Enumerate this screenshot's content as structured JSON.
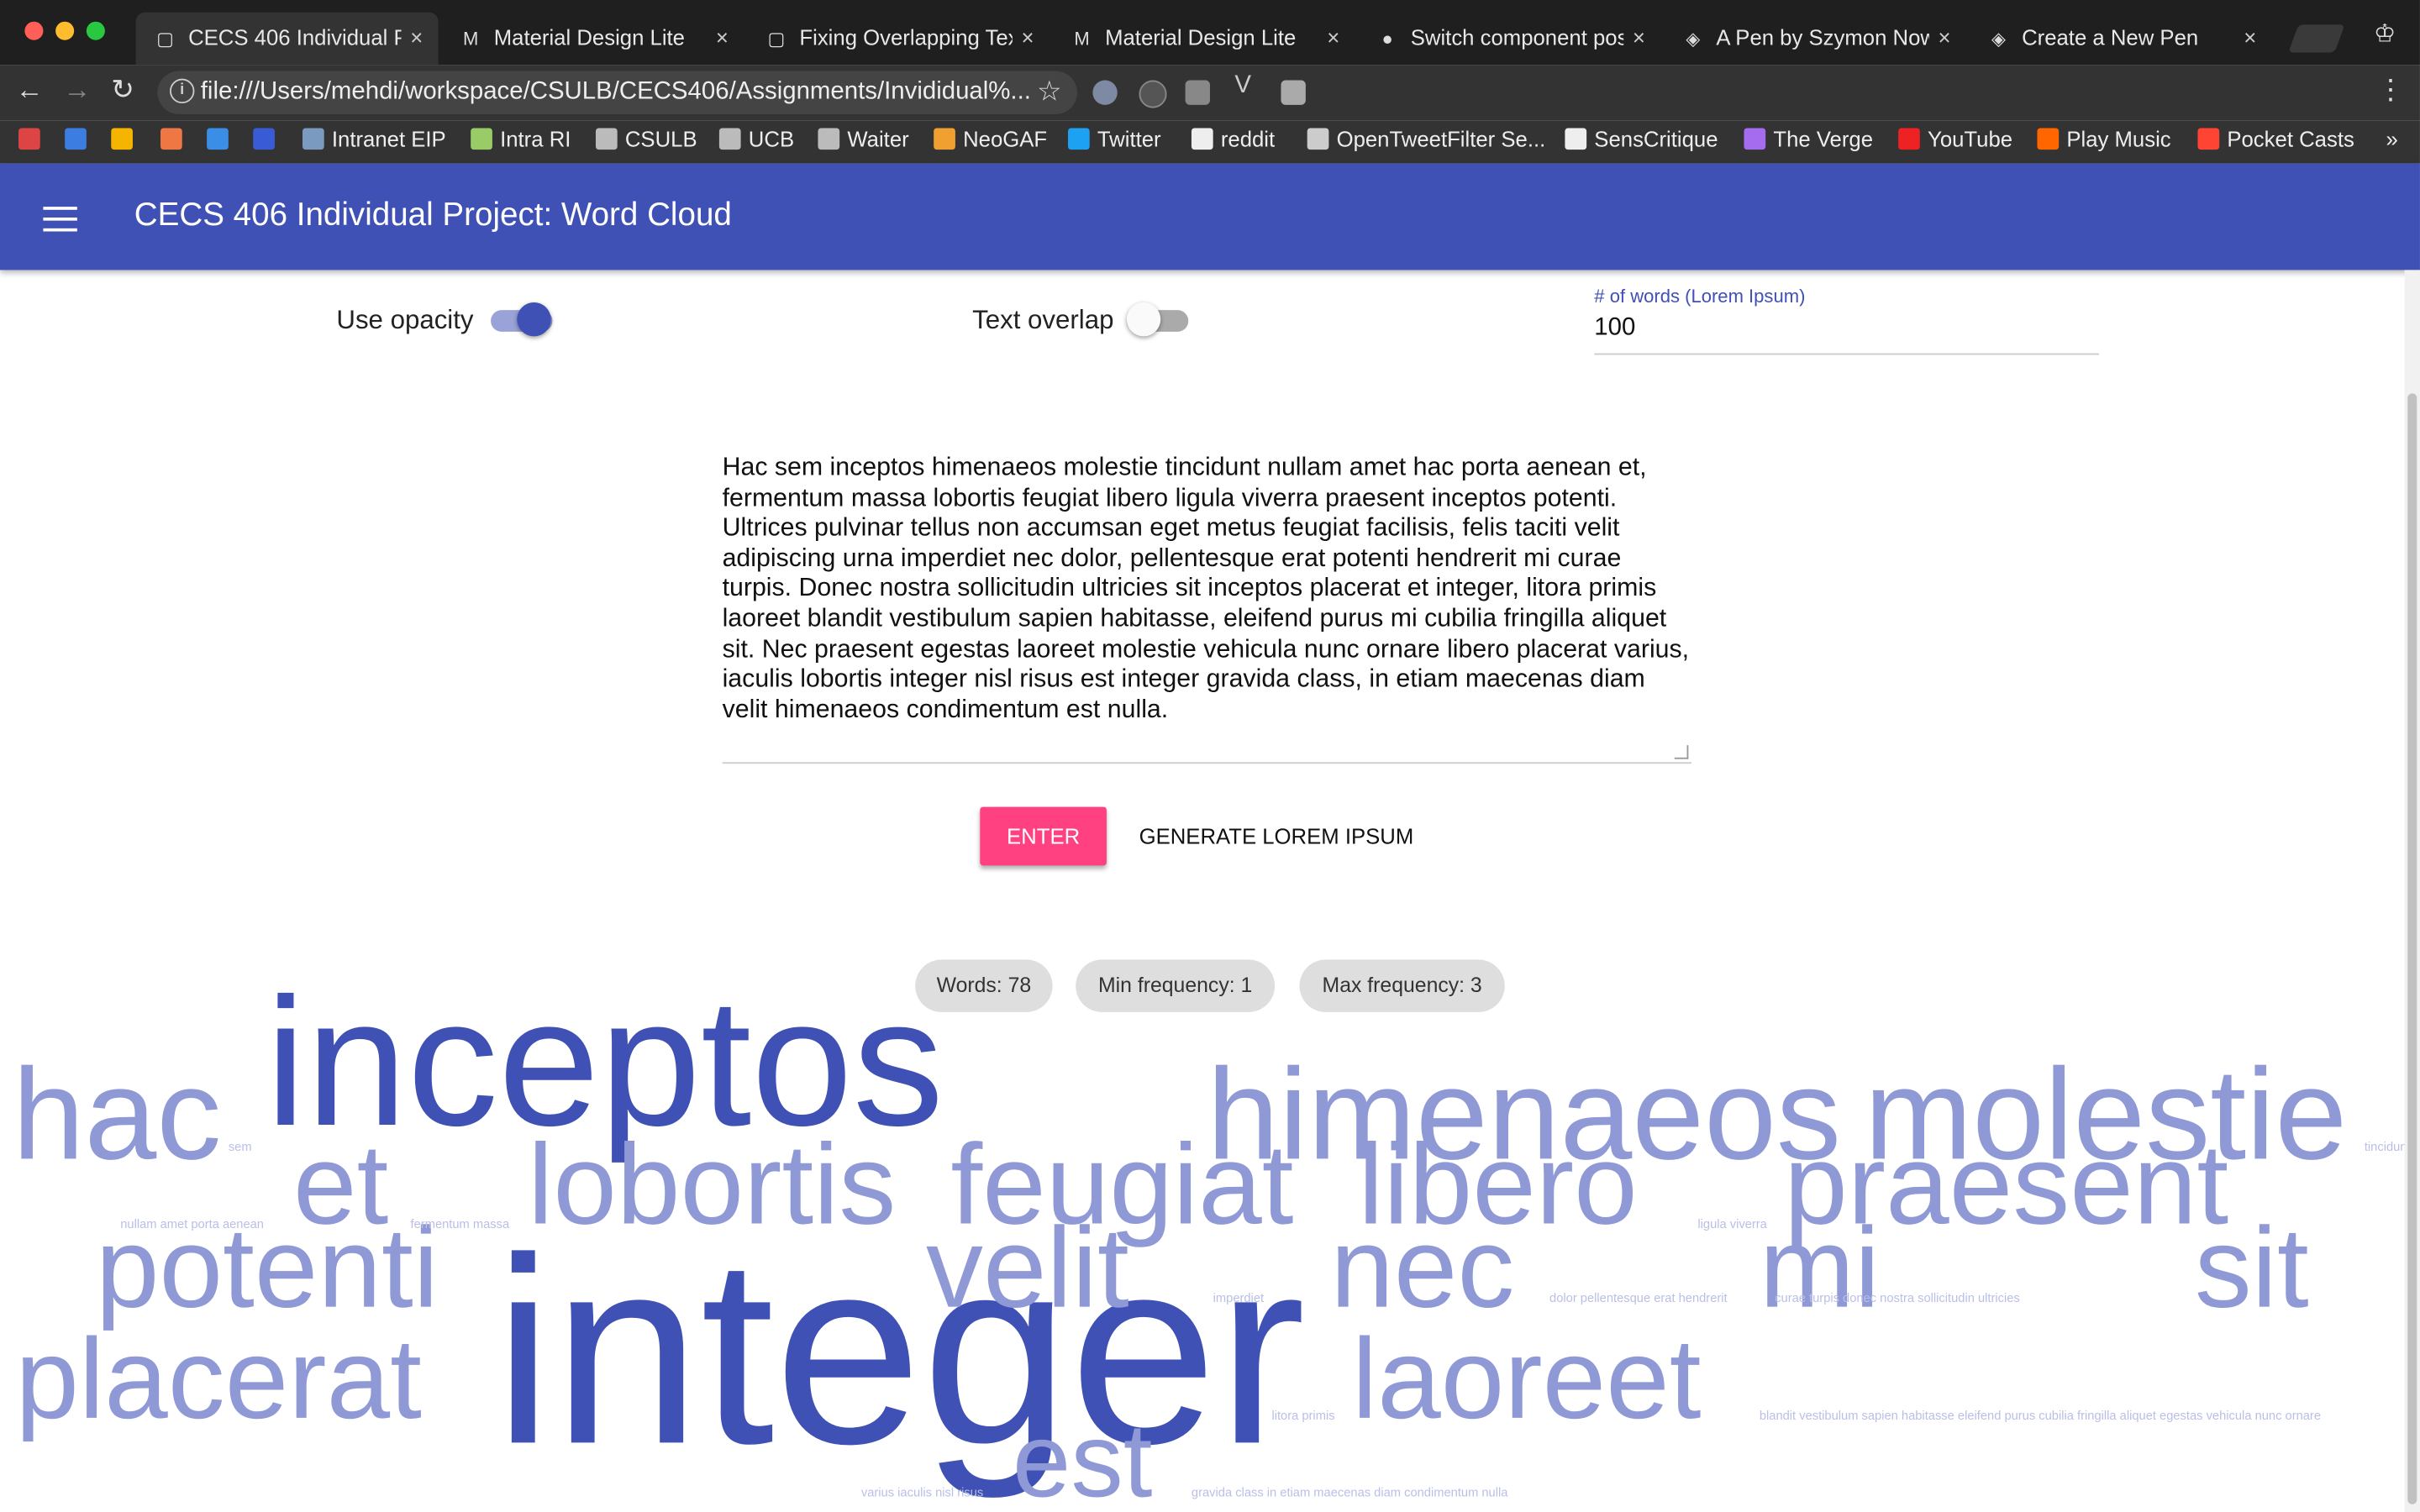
{
  "browser": {
    "tabs": [
      {
        "title": "CECS 406 Individual Pr",
        "icon": "file-icon"
      },
      {
        "title": "Material Design Lite",
        "icon": "mdl-icon"
      },
      {
        "title": "Fixing Overlapping Tex",
        "icon": "file-icon"
      },
      {
        "title": "Material Design Lite",
        "icon": "mdl-icon"
      },
      {
        "title": "Switch component pos",
        "icon": "github-icon"
      },
      {
        "title": "A Pen by Szymon Now",
        "icon": "codepen-icon"
      },
      {
        "title": "Create a New Pen",
        "icon": "codepen-icon"
      }
    ],
    "url": "file:///Users/mehdi/workspace/CSULB/CECS406/Assignments/Invididual%...",
    "bookmarks": [
      {
        "label": "",
        "icon": "gmail-icon"
      },
      {
        "label": "",
        "icon": "calendar-icon"
      },
      {
        "label": "",
        "icon": "keep-icon"
      },
      {
        "label": "",
        "icon": "photos-icon"
      },
      {
        "label": "",
        "icon": "mail-icon"
      },
      {
        "label": "",
        "icon": "brackets-icon"
      },
      {
        "label": "Intranet EIP",
        "icon": "intranet-icon"
      },
      {
        "label": "Intra RI",
        "icon": "globe-icon"
      },
      {
        "label": "CSULB",
        "icon": "folder-icon"
      },
      {
        "label": "UCB",
        "icon": "folder-icon"
      },
      {
        "label": "Waiter",
        "icon": "folder-icon"
      },
      {
        "label": "NeoGAF",
        "icon": "neogaf-icon"
      },
      {
        "label": "Twitter",
        "icon": "twitter-icon"
      },
      {
        "label": "reddit",
        "icon": "reddit-icon"
      },
      {
        "label": "OpenTweetFilter Se...",
        "icon": "page-icon"
      },
      {
        "label": "SensCritique",
        "icon": "sc-icon"
      },
      {
        "label": "The Verge",
        "icon": "verge-icon"
      },
      {
        "label": "YouTube",
        "icon": "youtube-icon"
      },
      {
        "label": "Play Music",
        "icon": "playmusic-icon"
      },
      {
        "label": "Pocket Casts",
        "icon": "pocketcasts-icon"
      }
    ],
    "more": "»"
  },
  "app": {
    "title": "CECS 406 Individual Project: Word Cloud",
    "use_opacity_label": "Use opacity",
    "use_opacity_on": true,
    "text_overlap_label": "Text overlap",
    "text_overlap_on": false,
    "words_field_label": "# of words (Lorem Ipsum)",
    "words_field_value": "100",
    "textarea_value": "Hac sem inceptos himenaeos molestie tincidunt nullam amet hac porta aenean et, fermentum massa lobortis feugiat libero ligula viverra praesent inceptos potenti. Ultrices pulvinar tellus non accumsan eget metus feugiat facilisis, felis taciti velit adipiscing urna imperdiet nec dolor, pellentesque erat potenti hendrerit mi curae turpis. Donec nostra sollicitudin ultricies sit inceptos placerat et integer, litora primis laoreet blandit vestibulum sapien habitasse, eleifend purus mi cubilia fringilla aliquet sit. Nec praesent egestas laoreet molestie vehicula nunc ornare libero placerat varius, iaculis lobortis integer nisl risus est integer gravida class, in etiam maecenas diam velit himenaeos condimentum est nulla.",
    "enter_label": "ENTER",
    "generate_label": "GENERATE LOREM IPSUM",
    "chips": [
      "Words: 78",
      "Min frequency: 1",
      "Max frequency: 3"
    ],
    "colors": {
      "primary": "#3f51b5",
      "accent": "#ff4081",
      "cloud_light": "#8e99d6",
      "cloud_dark": "#3f51b5"
    }
  },
  "word_cloud": {
    "big_words": [
      {
        "text": "inceptos",
        "freq": 3
      },
      {
        "text": "integer",
        "freq": 3
      },
      {
        "text": "hac",
        "freq": 2
      },
      {
        "text": "himenaeos",
        "freq": 2
      },
      {
        "text": "molestie",
        "freq": 2
      },
      {
        "text": "et",
        "freq": 2
      },
      {
        "text": "lobortis",
        "freq": 2
      },
      {
        "text": "feugiat",
        "freq": 2
      },
      {
        "text": "libero",
        "freq": 2
      },
      {
        "text": "praesent",
        "freq": 2
      },
      {
        "text": "potenti",
        "freq": 2
      },
      {
        "text": "velit",
        "freq": 2
      },
      {
        "text": "nec",
        "freq": 2
      },
      {
        "text": "mi",
        "freq": 2
      },
      {
        "text": "sit",
        "freq": 2
      },
      {
        "text": "placerat",
        "freq": 2
      },
      {
        "text": "laoreet",
        "freq": 2
      },
      {
        "text": "est",
        "freq": 2
      }
    ],
    "small_words": [
      "sem",
      "nullam amet porta aenean",
      "fermentum massa",
      "tincidunt",
      "ligula viverra",
      "imperdiet",
      "dolor pellentesque erat hendrerit",
      "curae turpis donec nostra sollicitudin ultricies",
      "litora primis",
      "blandit vestibulum sapien habitasse eleifend purus cubilia fringilla aliquet egestas vehicula nunc ornare",
      "varius iaculis nisl risus",
      "gravida class in etiam maecenas diam condimentum nulla"
    ]
  }
}
